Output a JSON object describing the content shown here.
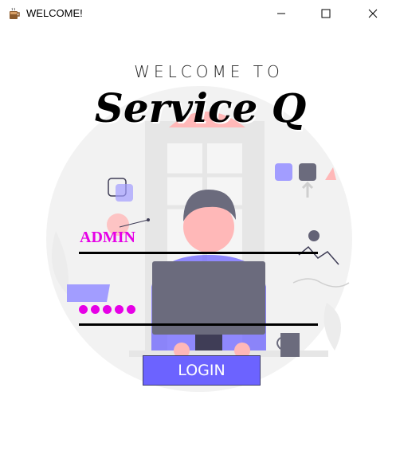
{
  "window": {
    "title": "WELCOME!",
    "icons": {
      "app": "coffee-app-icon",
      "minimize": "minimize-icon",
      "maximize": "maximize-icon",
      "close": "close-icon"
    }
  },
  "header": {
    "welcome": "WELCOME TO",
    "brand": "Service Q"
  },
  "form": {
    "username_value": "ADMIN",
    "password_value": "•••••",
    "password_length": 5,
    "login_label": "LOGIN"
  },
  "colors": {
    "accent": "#6c63ff",
    "field_text": "#e600e6",
    "illustration_grey": "#e6e6e6",
    "pink": "#ffb8b8"
  }
}
